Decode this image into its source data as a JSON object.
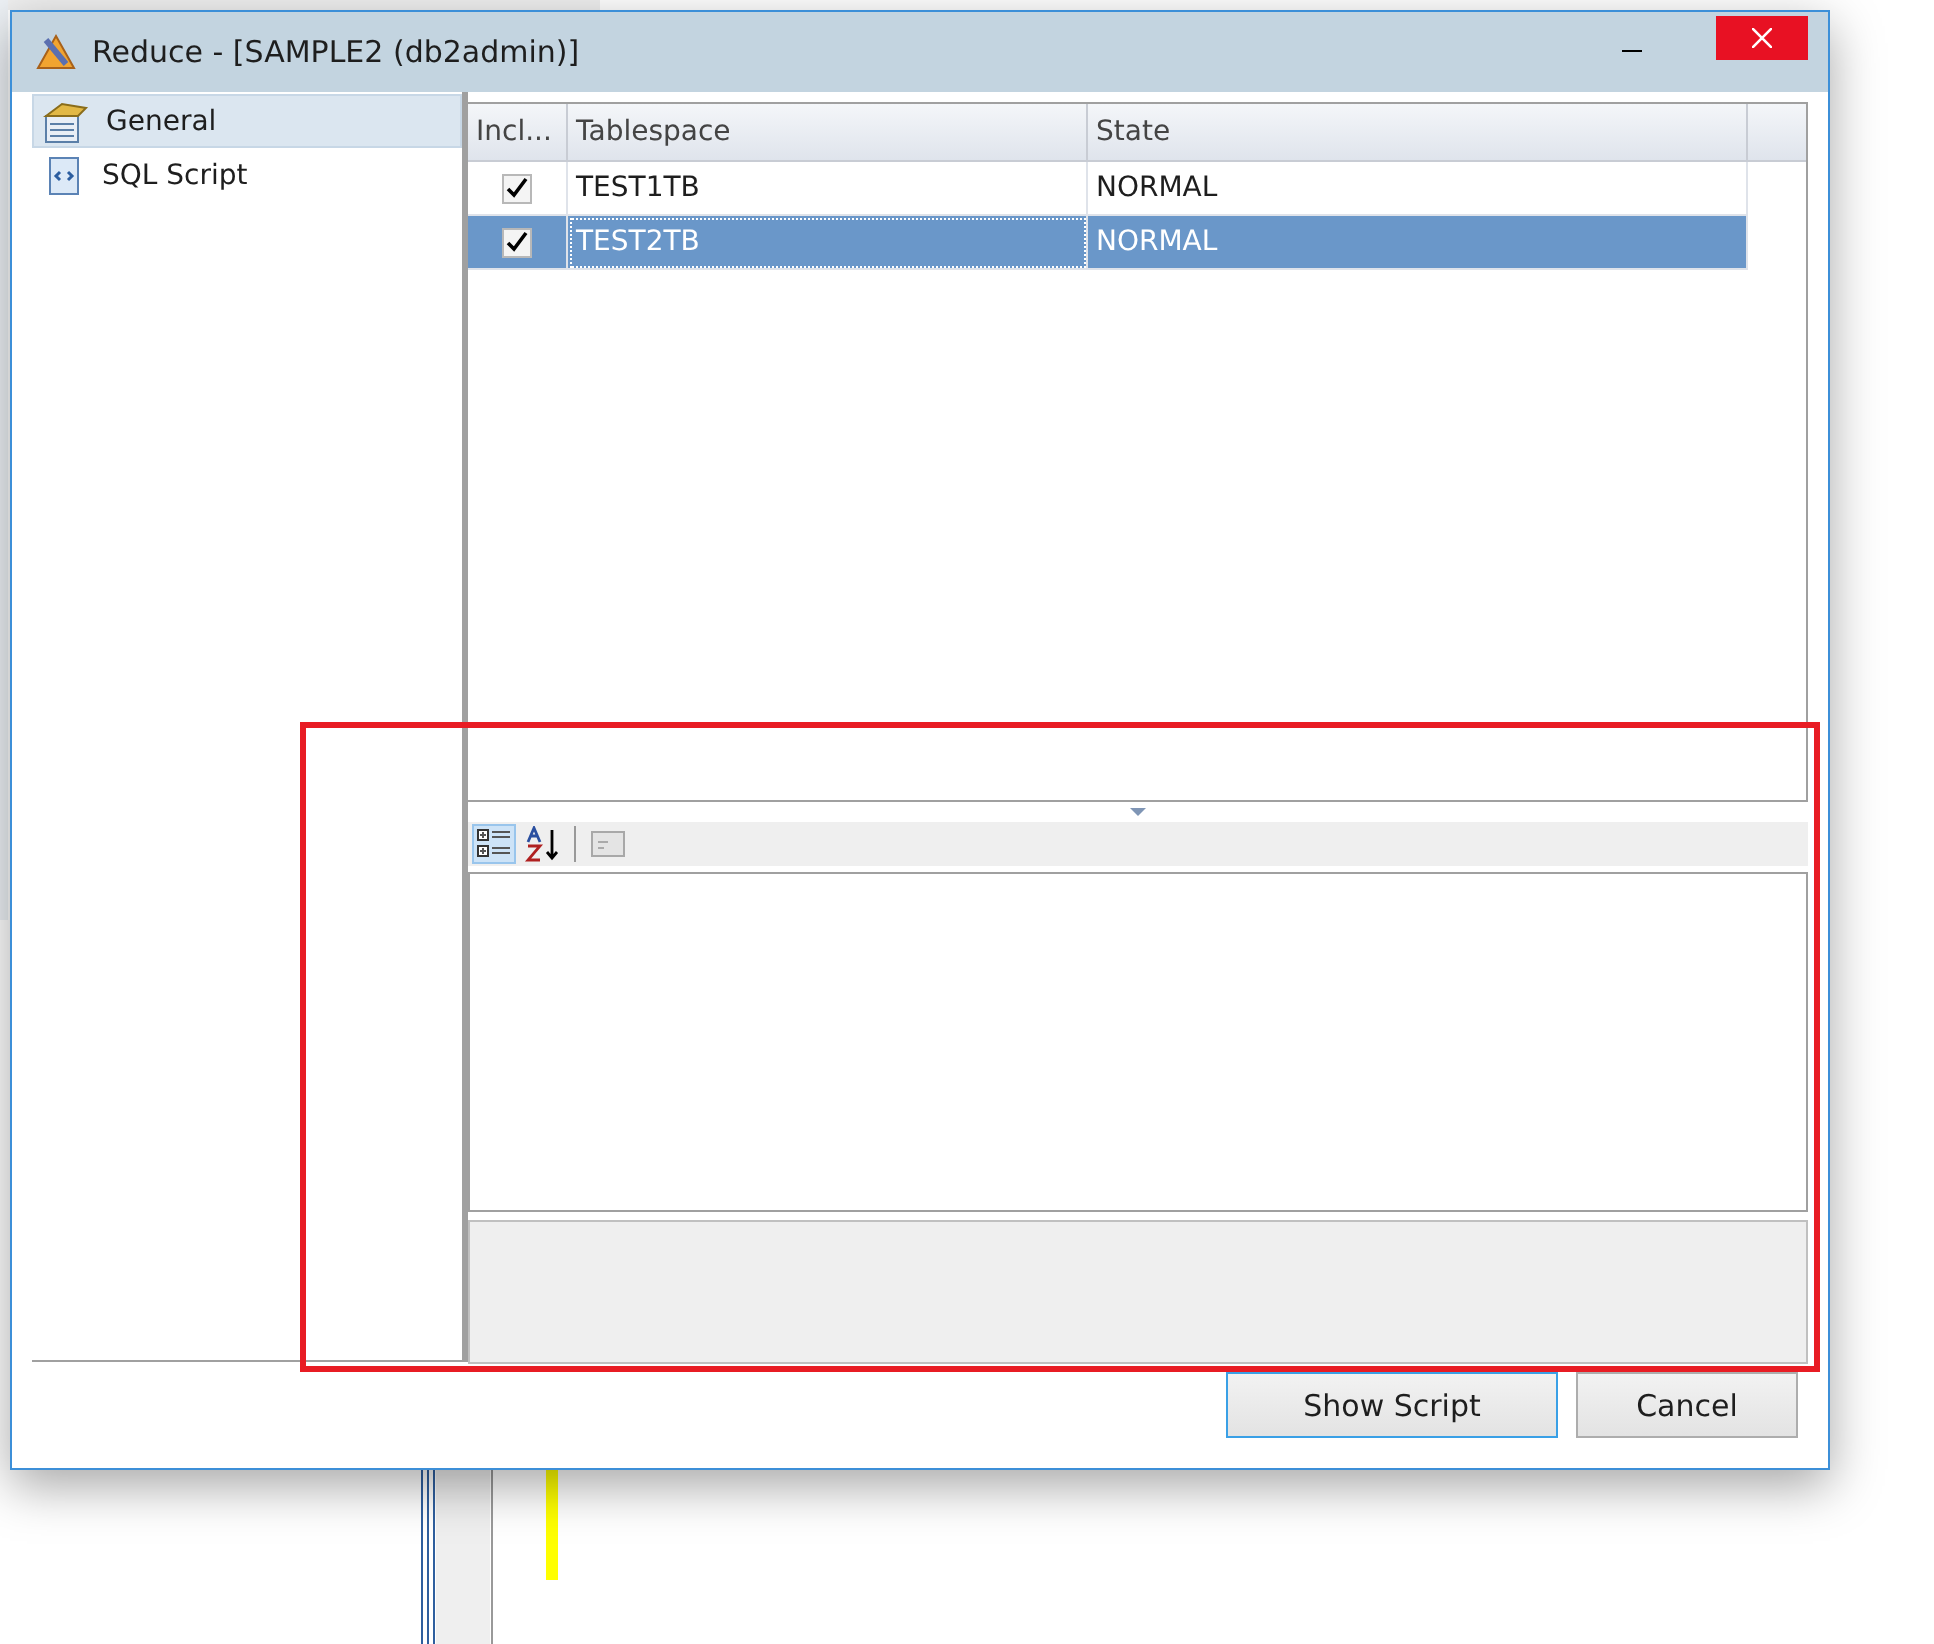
{
  "window": {
    "title": "Reduce - [SAMPLE2 (db2admin)]"
  },
  "nav": [
    {
      "label": "General",
      "kind": "general",
      "selected": true
    },
    {
      "label": "SQL Script",
      "kind": "script",
      "selected": false
    }
  ],
  "table": {
    "columns": [
      "Incl...",
      "Tablespace",
      "State"
    ],
    "rows": [
      {
        "included": true,
        "tablespace": "TEST1TB",
        "state": "NORMAL",
        "selected": false
      },
      {
        "included": true,
        "tablespace": "TEST2TB",
        "state": "NORMAL",
        "selected": true
      }
    ]
  },
  "property_toolbar": [
    {
      "kind": "categorized",
      "selected": true
    },
    {
      "kind": "alphabetical",
      "selected": false
    },
    {
      "kind": "pages",
      "selected": false
    }
  ],
  "buttons": [
    {
      "label": "Show Script",
      "default": true
    },
    {
      "label": "Cancel",
      "default": false
    }
  ]
}
